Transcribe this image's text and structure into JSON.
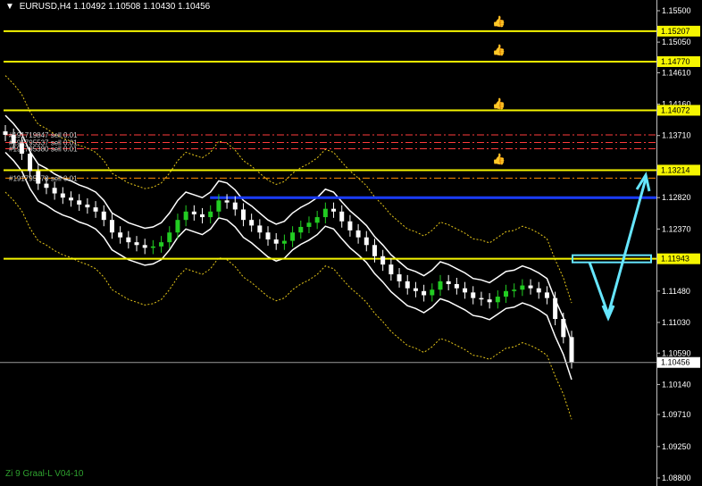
{
  "header": {
    "symbol": "EURUSD,H4",
    "ohlc": "1.10492 1.10508 1.10430 1.10456"
  },
  "footer": {
    "indicator": "Zi 9 Graal-L V04-10"
  },
  "colors": {
    "background": "#000000",
    "candle_up": "#22cc22",
    "candle_down": "#ffffff",
    "level": "#f5f500",
    "resistance": "#1a3cff",
    "arrow": "#66e6ff",
    "band": "#ffffff",
    "envelope": "#e6c619",
    "order_line": "#ff3b3b",
    "axis_text": "#ffffff"
  },
  "chart_data": {
    "type": "line",
    "ylim": [
      1.088,
      1.155
    ],
    "y_ticks": [
      "1.15500",
      "1.15050",
      "1.14610",
      "1.14160",
      "1.13710",
      "1.12820",
      "1.12370",
      "1.11480",
      "1.11030",
      "1.10590",
      "1.10140",
      "1.09710",
      "1.09250",
      "1.08800"
    ],
    "horizontal_levels": [
      {
        "label": "1.15207",
        "price": 1.15207,
        "color": "#f5f500"
      },
      {
        "label": "1.14770",
        "price": 1.1477,
        "color": "#f5f500"
      },
      {
        "label": "1.14072",
        "price": 1.14072,
        "color": "#f5f500"
      },
      {
        "label": "1.13214",
        "price": 1.13214,
        "color": "#f5f500"
      },
      {
        "label": "1.11943",
        "price": 1.11943,
        "color": "#f5f500"
      }
    ],
    "current_price": {
      "label": "1.10456",
      "price": 1.10456
    },
    "resistance_line": {
      "price": 1.1282,
      "x_start_frac": 0.32
    },
    "order_labels": [
      {
        "text": "#191719847 sell 0.01",
        "price": 1.1372
      },
      {
        "text": "#191795537 sell 0.01",
        "price": 1.1361
      },
      {
        "text": "#191795380 sell 0.01",
        "price": 1.1352
      },
      {
        "text": "#191795378 sell 0.01",
        "price": 1.131
      }
    ],
    "close_series": [
      1.1372,
      1.136,
      1.1345,
      1.132,
      1.1302,
      1.1296,
      1.1288,
      1.1282,
      1.1278,
      1.1272,
      1.1268,
      1.1262,
      1.125,
      1.1232,
      1.1225,
      1.1218,
      1.1214,
      1.121,
      1.1212,
      1.1218,
      1.1232,
      1.125,
      1.1262,
      1.1258,
      1.1254,
      1.1262,
      1.1278,
      1.1275,
      1.1265,
      1.125,
      1.1242,
      1.1232,
      1.1222,
      1.1216,
      1.122,
      1.1232,
      1.124,
      1.1246,
      1.1254,
      1.1266,
      1.1262,
      1.1248,
      1.1235,
      1.1225,
      1.1214,
      1.1198,
      1.1186,
      1.1172,
      1.1162,
      1.1152,
      1.1148,
      1.1142,
      1.115,
      1.1162,
      1.1158,
      1.1152,
      1.1146,
      1.1138,
      1.1136,
      1.1132,
      1.114,
      1.1148,
      1.115,
      1.1156,
      1.1152,
      1.1146,
      1.1138,
      1.1108,
      1.1082,
      1.1046
    ]
  }
}
